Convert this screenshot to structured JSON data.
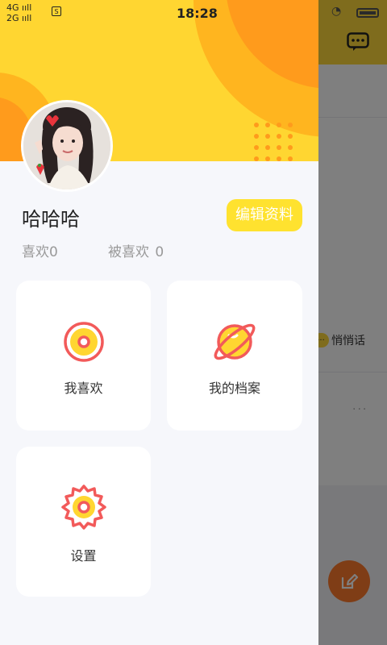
{
  "status_bar": {
    "network_top": "4G ııll",
    "network_bottom": "2G ııll",
    "sim_badge": "S",
    "time": "18:28"
  },
  "profile": {
    "name": "哈哈哈",
    "edit_label": "编辑资料",
    "likes_label": "喜欢",
    "likes_count": "0",
    "liked_by_label": "被喜欢",
    "liked_by_count": "0"
  },
  "menu": [
    {
      "label": "我喜欢",
      "icon": "target-icon"
    },
    {
      "label": "我的档案",
      "icon": "planet-icon"
    },
    {
      "label": "设置",
      "icon": "gear-icon"
    }
  ],
  "background": {
    "whisper_label": "悄悄话",
    "more_label": "···",
    "fab_icon": "edit-icon",
    "message_icon": "message-icon"
  },
  "colors": {
    "header_yellow": "#ffd631",
    "header_orange": "#ff9b1c",
    "accent_yellow": "#ffe22f",
    "icon_red": "#f25a5a"
  }
}
